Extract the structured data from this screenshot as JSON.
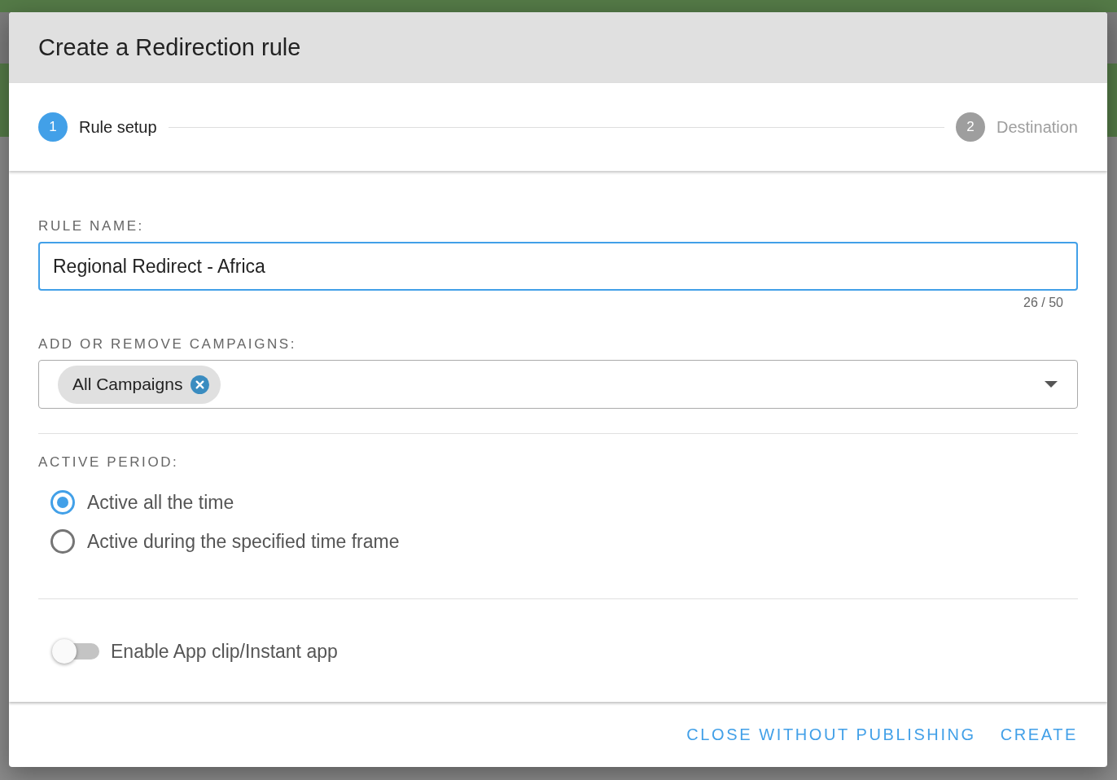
{
  "dialog": {
    "title": "Create a Redirection rule"
  },
  "steps": [
    {
      "number": "1",
      "label": "Rule setup",
      "selected": true
    },
    {
      "number": "2",
      "label": "Destination",
      "selected": false
    }
  ],
  "rule_name": {
    "label": "RULE NAME:",
    "value": "Regional Redirect - Africa",
    "counter": "26 / 50"
  },
  "campaigns": {
    "label": "ADD OR REMOVE CAMPAIGNS:",
    "chips": [
      "All Campaigns"
    ]
  },
  "active_period": {
    "label": "ACTIVE PERIOD:",
    "options": [
      {
        "label": "Active all the time",
        "selected": true
      },
      {
        "label": "Active during the specified time frame",
        "selected": false
      }
    ]
  },
  "app_clip": {
    "label": "Enable App clip/Instant app",
    "on": false
  },
  "buttons": [
    {
      "label": "CLOSE WITHOUT PUBLISHING"
    },
    {
      "label": "CREATE"
    }
  ]
}
